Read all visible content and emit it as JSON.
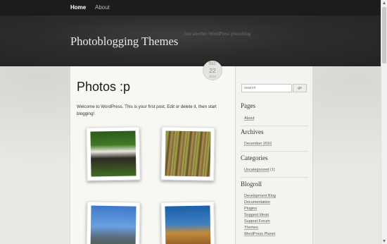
{
  "nav": {
    "items": [
      {
        "label": "Home"
      },
      {
        "label": "About"
      }
    ]
  },
  "header": {
    "site_title": "Photoblogging Themes",
    "tagline": "Just another WordPress photoblog"
  },
  "post": {
    "title": "Photos :p",
    "body": "Welcome to WordPress. This is your first post. Edit or delete it, then start blogging!",
    "date": {
      "month": "DEC",
      "day": "22",
      "year": "2010"
    },
    "photos": [
      {
        "icon": "couple-photo"
      },
      {
        "icon": "abstract-grass-photo"
      },
      {
        "icon": "castle-sky-photo"
      },
      {
        "icon": "wheat-sky-photo"
      }
    ]
  },
  "sidebar": {
    "search": {
      "placeholder": "search",
      "button": "go"
    },
    "pages": {
      "title": "Pages",
      "items": [
        "About"
      ]
    },
    "archives": {
      "title": "Archives",
      "items": [
        "December 2010"
      ]
    },
    "categories": {
      "title": "Categories",
      "items": [
        {
          "label": "Uncategorized",
          "count": "(1)"
        }
      ]
    },
    "blogroll": {
      "title": "Blogroll",
      "items": [
        "Development Blog",
        "Documentation",
        "Plugins",
        "Suggest Ideas",
        "Support Forum",
        "Themes",
        "WordPress Planet"
      ]
    }
  }
}
